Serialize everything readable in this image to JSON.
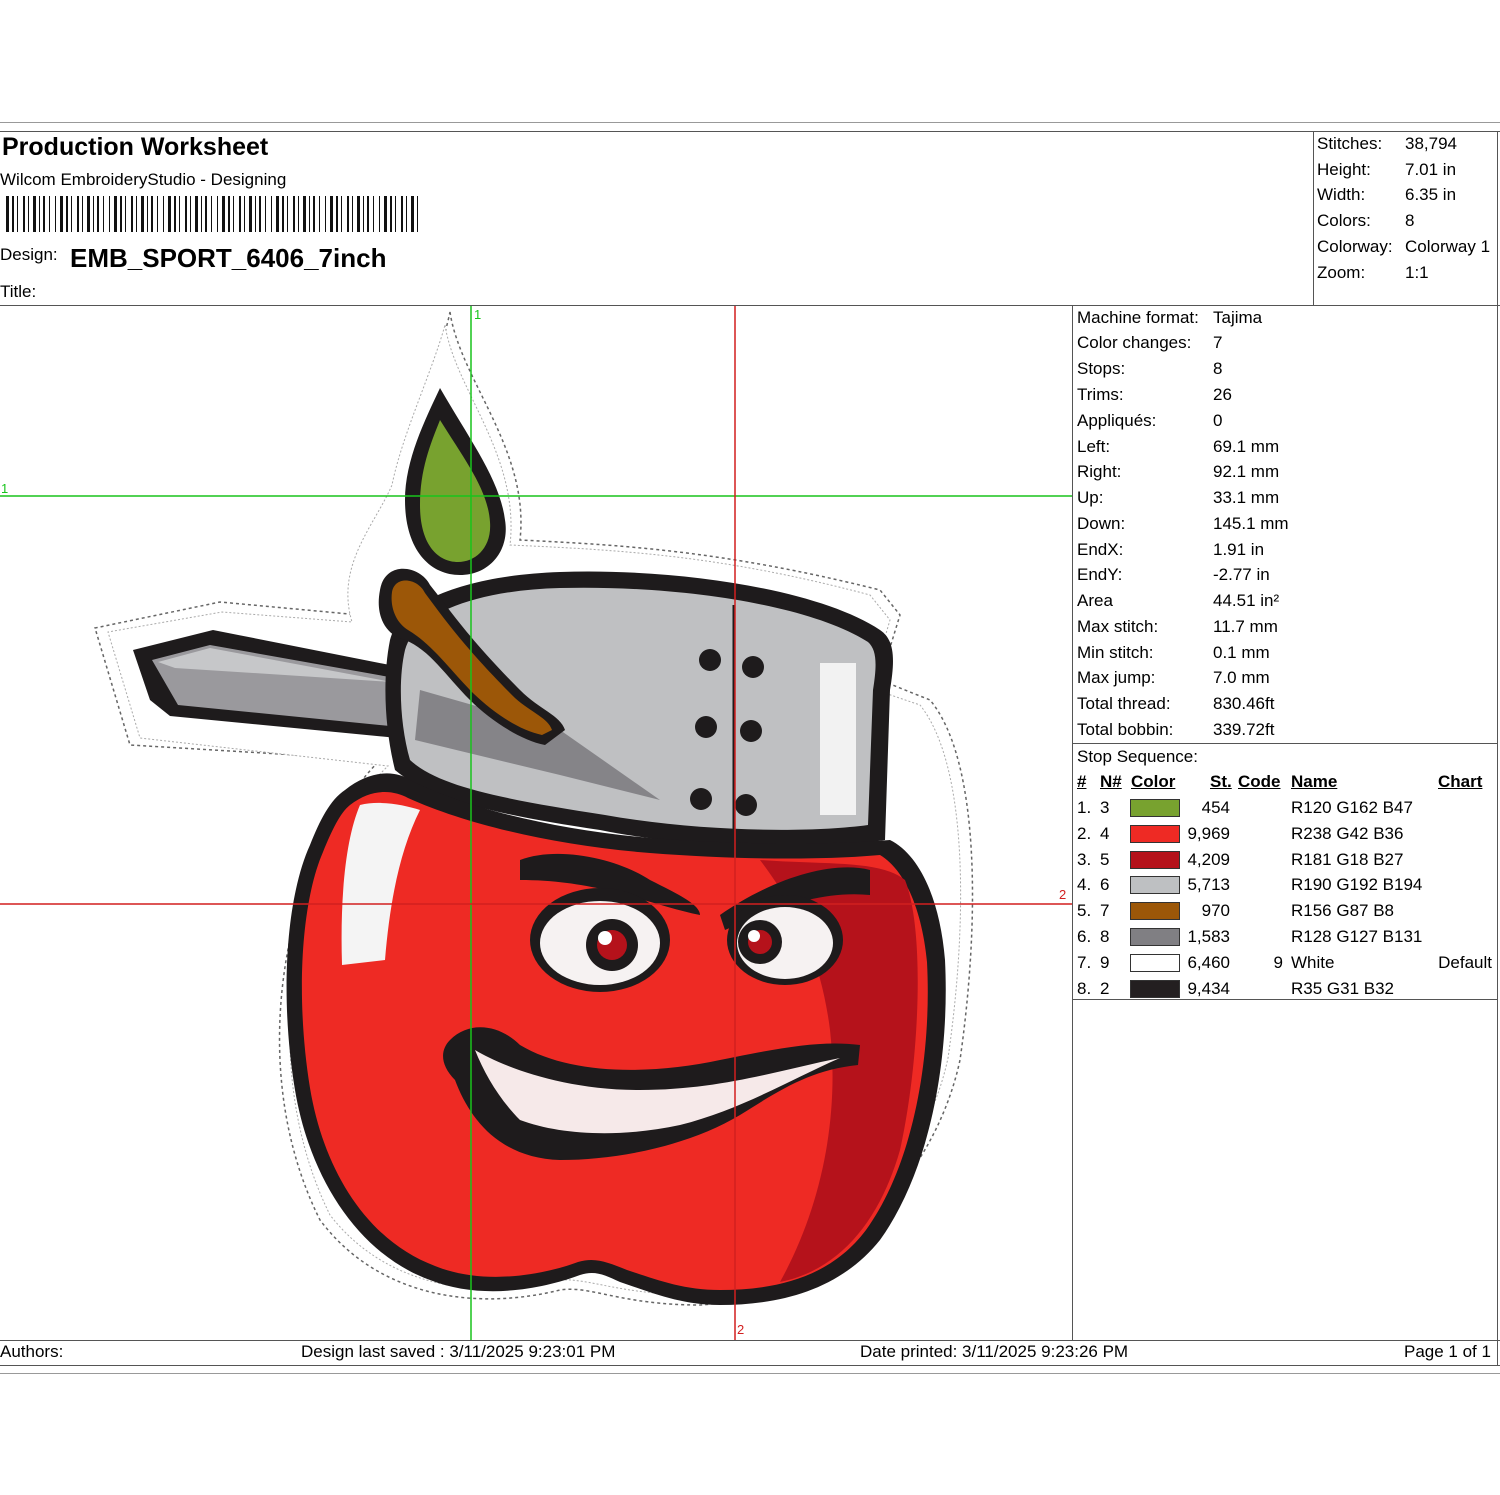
{
  "header": {
    "title": "Production Worksheet",
    "software": "Wilcom EmbroideryStudio - Designing",
    "design_label": "Design:",
    "design_name": "EMB_SPORT_6406_7inch",
    "title_label": "Title:"
  },
  "summary": [
    {
      "label": "Stitches:",
      "value": "38,794"
    },
    {
      "label": "Height:",
      "value": "7.01 in"
    },
    {
      "label": "Width:",
      "value": "6.35 in"
    },
    {
      "label": "Colors:",
      "value": "8"
    },
    {
      "label": "Colorway:",
      "value": "Colorway 1"
    },
    {
      "label": "Zoom:",
      "value": "1:1"
    }
  ],
  "machine": [
    {
      "label": "Machine format:",
      "value": "Tajima"
    },
    {
      "label": "Color changes:",
      "value": "7"
    },
    {
      "label": "Stops:",
      "value": "8"
    },
    {
      "label": "Trims:",
      "value": "26"
    },
    {
      "label": "Appliqués:",
      "value": "0"
    },
    {
      "label": "Left:",
      "value": "69.1 mm"
    },
    {
      "label": "Right:",
      "value": "92.1 mm"
    },
    {
      "label": "Up:",
      "value": "33.1 mm"
    },
    {
      "label": "Down:",
      "value": "145.1 mm"
    },
    {
      "label": "EndX:",
      "value": "1.91 in"
    },
    {
      "label": "EndY:",
      "value": "-2.77 in"
    },
    {
      "label": "Area",
      "value": " 44.51 in²"
    },
    {
      "label": "Max stitch:",
      "value": "11.7 mm"
    },
    {
      "label": "Min stitch:",
      "value": "0.1 mm"
    },
    {
      "label": "Max jump:",
      "value": "7.0 mm"
    },
    {
      "label": "Total thread:",
      "value": "830.46ft"
    },
    {
      "label": "Total bobbin:",
      "value": "339.72ft"
    }
  ],
  "stop_sequence": {
    "heading": "Stop Sequence:",
    "columns": {
      "num": "#",
      "n": "N#",
      "color": "Color",
      "st": "St.",
      "code": "Code",
      "name": "Name",
      "chart": "Chart"
    },
    "rows": [
      {
        "num": "1.",
        "n": "3",
        "swatch": "#78A22F",
        "st": "454",
        "code": "",
        "name": "R120 G162 B47",
        "chart": ""
      },
      {
        "num": "2.",
        "n": "4",
        "swatch": "#EE2A24",
        "st": "9,969",
        "code": "",
        "name": "R238 G42 B36",
        "chart": ""
      },
      {
        "num": "3.",
        "n": "5",
        "swatch": "#B5121B",
        "st": "4,209",
        "code": "",
        "name": "R181 G18 B27",
        "chart": ""
      },
      {
        "num": "4.",
        "n": "6",
        "swatch": "#BEC0C2",
        "st": "5,713",
        "code": "",
        "name": "R190 G192 B194",
        "chart": ""
      },
      {
        "num": "5.",
        "n": "7",
        "swatch": "#9C5708",
        "st": "970",
        "code": "",
        "name": "R156 G87 B8",
        "chart": ""
      },
      {
        "num": "6.",
        "n": "8",
        "swatch": "#807F83",
        "st": "1,583",
        "code": "",
        "name": "R128 G127 B131",
        "chart": ""
      },
      {
        "num": "7.",
        "n": "9",
        "swatch": "#FFFFFF",
        "st": "6,460",
        "code": "9",
        "name": "White",
        "chart": "Default"
      },
      {
        "num": "8.",
        "n": "2",
        "swatch": "#231F20",
        "st": "9,434",
        "code": "",
        "name": "R35 G31 B32",
        "chart": ""
      }
    ]
  },
  "guides": {
    "green_1": "1",
    "red_2": "2"
  },
  "footer": {
    "authors": "Authors:",
    "saved": "Design last saved : 3/11/2025 9:23:01 PM",
    "printed": "Date printed: 3/11/2025 9:23:26 PM",
    "page": "Page 1 of 1"
  }
}
